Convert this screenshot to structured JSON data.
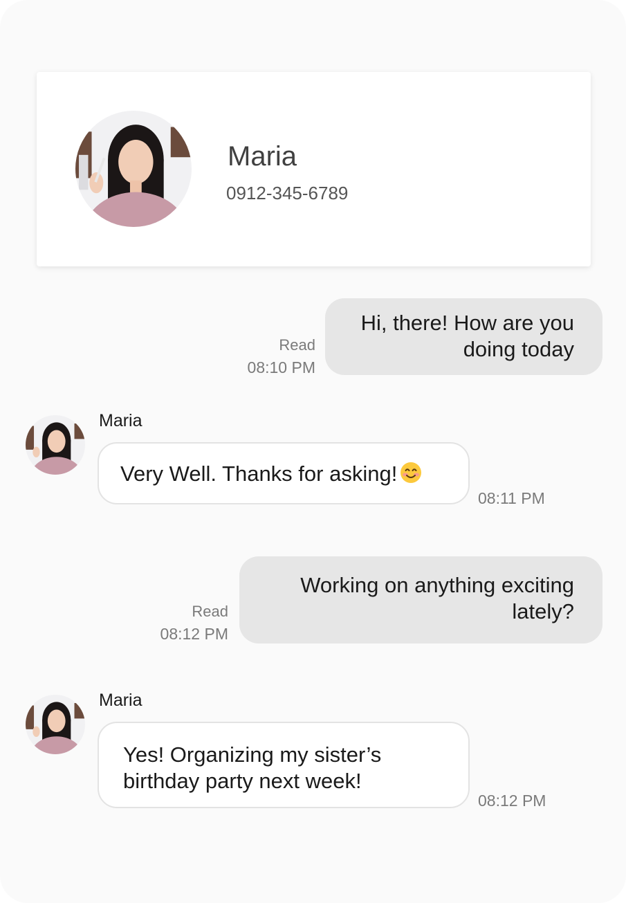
{
  "contact": {
    "name": "Maria",
    "phone": "0912-345-6789"
  },
  "messages": [
    {
      "direction": "outgoing",
      "text": "Hi, there! How are you doing today",
      "status": "Read",
      "time": "08:10 PM"
    },
    {
      "direction": "incoming",
      "sender": "Maria",
      "text": "Very Well. Thanks for asking!",
      "emoji": "smiling-face-emoji",
      "time": "08:11 PM"
    },
    {
      "direction": "outgoing",
      "text": "Working on anything exciting lately?",
      "status": "Read",
      "time": "08:12 PM"
    },
    {
      "direction": "incoming",
      "sender": "Maria",
      "text": "Yes! Organizing my sister’s birthday party next week!",
      "time": "08:12 PM"
    }
  ],
  "colors": {
    "background": "#fafafa",
    "outgoing_bubble": "#e6e6e6",
    "incoming_bubble": "#ffffff",
    "meta_text": "#7a7a7a"
  }
}
